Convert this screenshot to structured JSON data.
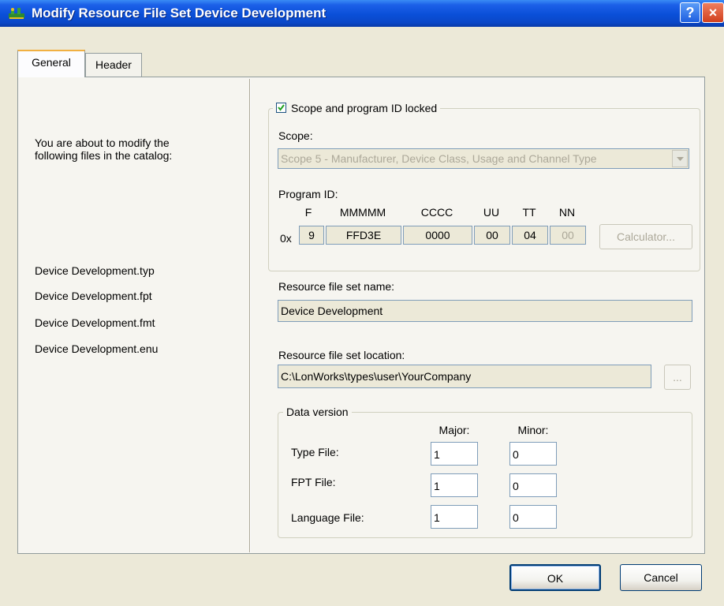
{
  "window": {
    "title": "Modify Resource File Set Device Development",
    "help_label": "?",
    "close_label": "×"
  },
  "tabs": [
    {
      "label": "General",
      "active": true
    },
    {
      "label": "Header",
      "active": false
    }
  ],
  "left": {
    "intro_line1": "You are about to modify the",
    "intro_line2": "following files in the catalog:",
    "files": [
      "Device Development.typ",
      "Device Development.fpt",
      "Device Development.fmt",
      "Device Development.enu"
    ]
  },
  "scope_group": {
    "checkbox_label": "Scope and program ID locked",
    "checked": true,
    "scope_label": "Scope:",
    "scope_value": "Scope 5 - Manufacturer, Device Class, Usage and Channel Type",
    "program_id_label": "Program ID:",
    "prefix": "0x",
    "columns": [
      {
        "header": "F",
        "value": "9"
      },
      {
        "header": "MMMMM",
        "value": "FFD3E"
      },
      {
        "header": "CCCC",
        "value": "0000"
      },
      {
        "header": "UU",
        "value": "00"
      },
      {
        "header": "TT",
        "value": "04"
      },
      {
        "header": "NN",
        "value": "00"
      }
    ],
    "calculator_label": "Calculator..."
  },
  "resource": {
    "name_label": "Resource file set name:",
    "name_value": "Device Development",
    "location_label": "Resource file set location:",
    "location_value": "C:\\LonWorks\\types\\user\\YourCompany",
    "browse_label": "..."
  },
  "data_version": {
    "legend": "Data version",
    "major_label": "Major:",
    "minor_label": "Minor:",
    "rows": [
      {
        "label": "Type File:",
        "major": "1",
        "minor": "0"
      },
      {
        "label": "FPT File:",
        "major": "1",
        "minor": "0"
      },
      {
        "label": "Language File:",
        "major": "1",
        "minor": "0"
      }
    ]
  },
  "footer": {
    "ok_label": "OK",
    "cancel_label": "Cancel"
  }
}
